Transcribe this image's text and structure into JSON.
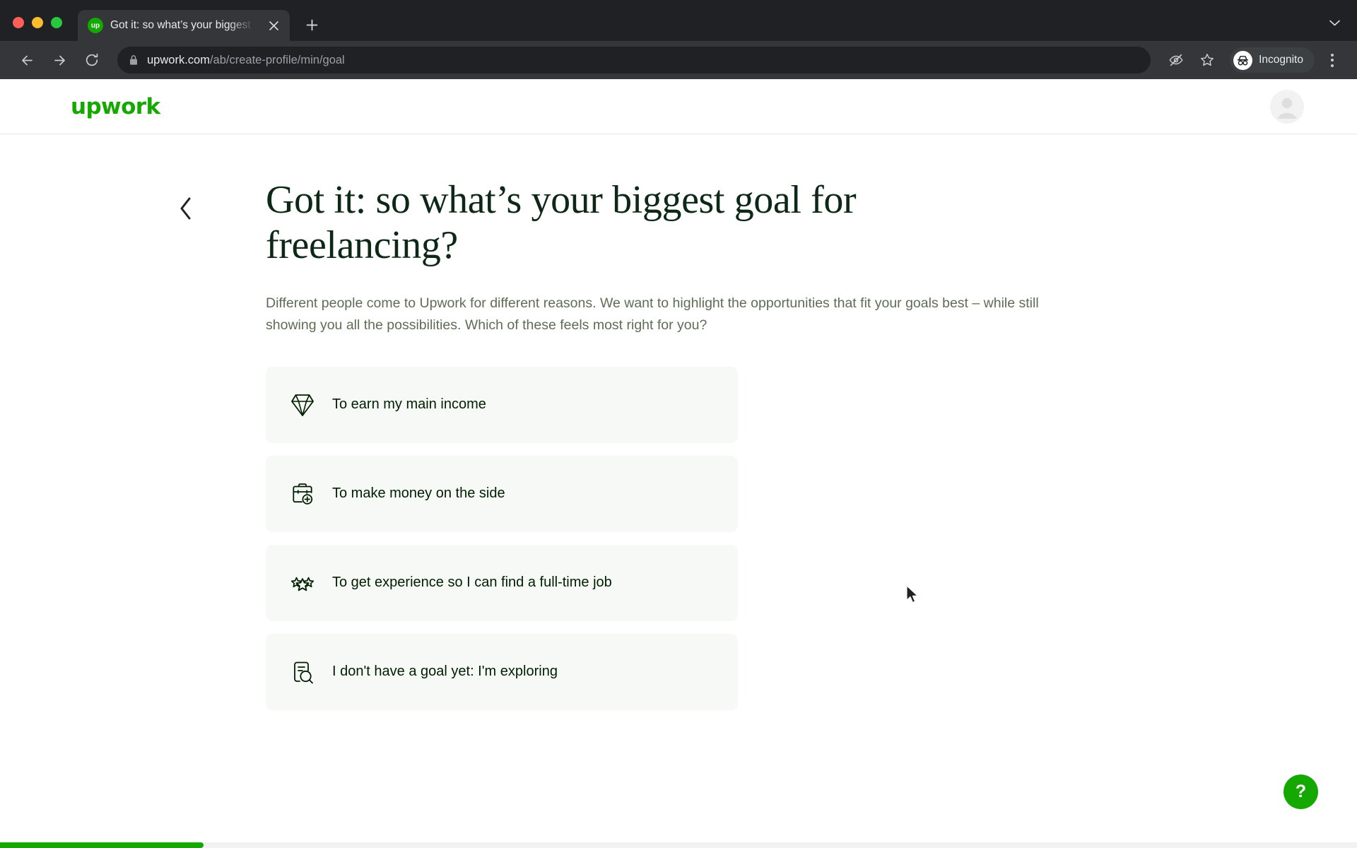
{
  "browser": {
    "tab": {
      "title": "Got it: so what’s your biggest g",
      "favicon_label": "up",
      "favicon_color": "#14a800",
      "close_icon": "close-icon"
    },
    "new_tab_label": "+",
    "tab_list_chevron": "▾",
    "toolbar": {
      "back_icon": "back-arrow-icon",
      "forward_icon": "forward-arrow-icon",
      "reload_icon": "reload-icon",
      "lock_icon": "lock-icon",
      "url_host": "upwork.com",
      "url_path": "/ab/create-profile/min/goal",
      "tracking_protection_icon": "eye-off-icon",
      "bookmark_icon": "star-icon",
      "incognito_label": "Incognito",
      "incognito_icon": "incognito-icon",
      "menu_icon": "kebab-menu-icon"
    }
  },
  "page": {
    "header": {
      "logo_text": "upwork",
      "logo_color": "#14a800",
      "avatar_icon": "user-avatar-icon"
    },
    "back_icon": "chevron-left-icon",
    "headline": "Got it: so what’s your biggest goal for freelancing?",
    "subtitle": "Different people come to Upwork for different reasons. We want to highlight the opportunities that fit your goals best – while still showing you all the possibilities. Which of these feels most right for you?",
    "options": [
      {
        "label": "To earn my main income",
        "icon": "diamond-icon"
      },
      {
        "label": "To make money on the side",
        "icon": "briefcase-plus-icon"
      },
      {
        "label": "To get experience so I can find a full-time job",
        "icon": "three-stars-icon"
      },
      {
        "label": "I don't have a goal yet: I'm exploring",
        "icon": "document-search-icon"
      }
    ],
    "help_button": {
      "label": "?",
      "icon": "question-mark-icon",
      "color": "#14a800"
    },
    "progress": {
      "percent": 15,
      "fill_color": "#14a800",
      "track_color": "#f2f2f2"
    }
  }
}
